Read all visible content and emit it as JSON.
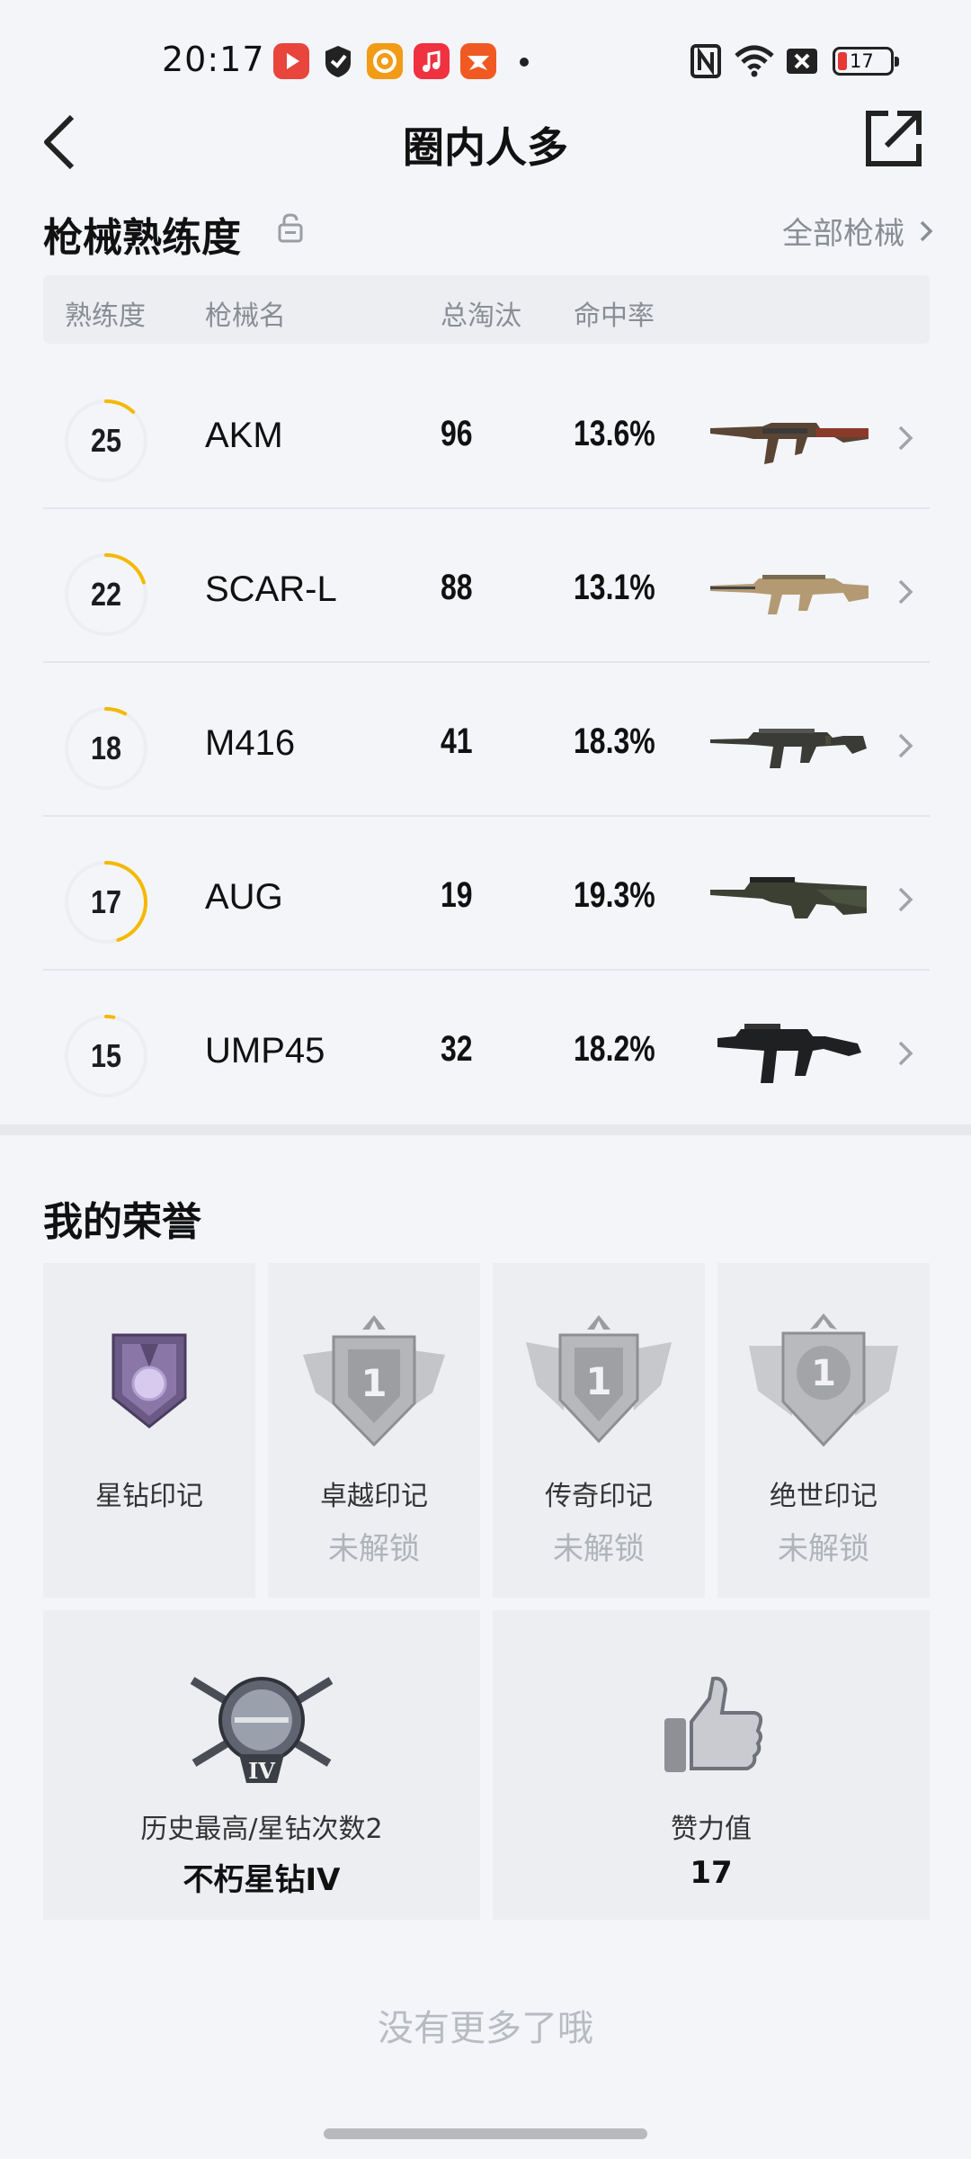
{
  "status_bar": {
    "time": "20:17",
    "battery": "17",
    "icons": [
      "video-app-icon",
      "shield-app-icon",
      "orange-app-icon",
      "music-app-icon",
      "game-app-icon",
      "nfc-icon",
      "wifi-icon",
      "close-box-icon",
      "battery-icon"
    ]
  },
  "nav": {
    "title": "圈内人多"
  },
  "weapons": {
    "title": "枪械熟练度",
    "all_link": "全部枪械",
    "columns": [
      "熟练度",
      "枪械名",
      "总淘汰",
      "命中率"
    ],
    "rows": [
      {
        "level": "25",
        "name": "AKM",
        "kills": "96",
        "hit_rate": "13.6%",
        "progress": 0.12
      },
      {
        "level": "22",
        "name": "SCAR-L",
        "kills": "88",
        "hit_rate": "13.1%",
        "progress": 0.2
      },
      {
        "level": "18",
        "name": "M416",
        "kills": "41",
        "hit_rate": "18.3%",
        "progress": 0.08
      },
      {
        "level": "17",
        "name": "AUG",
        "kills": "19",
        "hit_rate": "19.3%",
        "progress": 0.45
      },
      {
        "level": "15",
        "name": "UMP45",
        "kills": "32",
        "hit_rate": "18.2%",
        "progress": 0.03
      }
    ]
  },
  "honors": {
    "title": "我的荣誉",
    "marks": [
      {
        "name": "星钻印记",
        "status": ""
      },
      {
        "name": "卓越印记",
        "status": "未解锁",
        "emblem_num": "1"
      },
      {
        "name": "传奇印记",
        "status": "未解锁",
        "emblem_num": "1"
      },
      {
        "name": "绝世印记",
        "status": "未解锁",
        "emblem_num": "1"
      }
    ],
    "rank": {
      "label": "历史最高/星钻次数2",
      "value": "不朽星钻IV",
      "emblem_text": "IV"
    },
    "likes": {
      "label": "赞力值",
      "value": "17"
    }
  },
  "footer": "没有更多了哦",
  "colors": {
    "progress": "#f5b800",
    "ring_track": "#eceef1",
    "background": "#f3f5f9"
  }
}
